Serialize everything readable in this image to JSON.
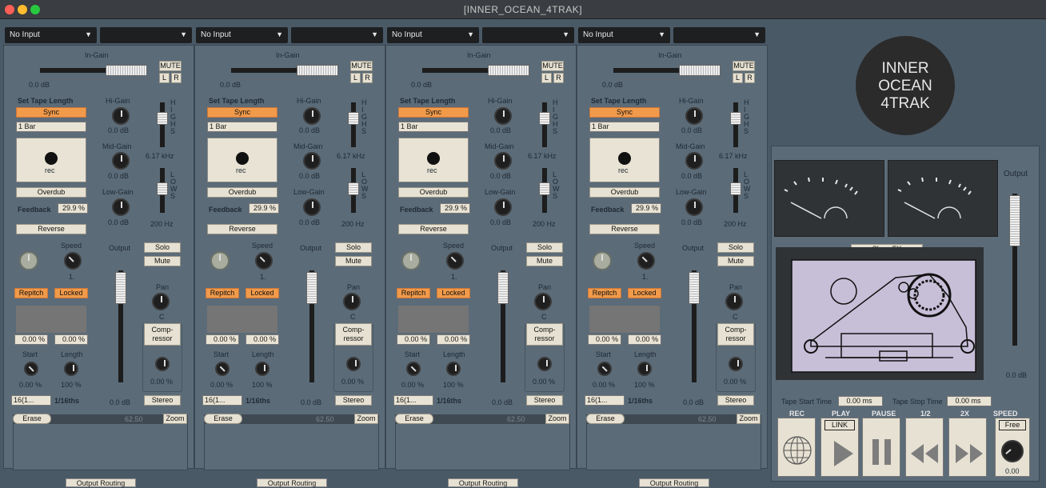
{
  "window": {
    "title": "[INNER_OCEAN_4TRAK]"
  },
  "logo": {
    "line1": "INNER",
    "line2": "OCEAN",
    "line3": "4TRAK"
  },
  "tracks": [
    {
      "input": "No Input",
      "routing": "",
      "in_gain": "In-Gain",
      "mute": "MUTE",
      "l": "L",
      "r": "R",
      "gain_db": "0.0 dB",
      "set_tape_length": "Set Tape Length",
      "sync": "Sync",
      "length": "1 Bar",
      "rec": "rec",
      "overdub": "Overdub",
      "feedback": "Feedback",
      "feedback_val": "29.9 %",
      "reverse": "Reverse",
      "speed": "Speed",
      "speed_val": "1.",
      "repitch": "Repitch",
      "locked": "Locked",
      "pct_a": "0.00 %",
      "pct_b": "0.00 %",
      "start": "Start",
      "start_val": "0.00 %",
      "length_lbl": "Length",
      "length_val": "100 %",
      "grid": "16(1...",
      "grid2": "1/16ths",
      "hi_gain": "Hi-Gain",
      "hi_val": "0.0 dB",
      "mid_gain": "Mid-Gain",
      "mid_val": "0.0 dB",
      "freq": "6.17 kHz",
      "low_gain": "Low-Gain",
      "low_val": "0.0 dB",
      "low_freq": "200 Hz",
      "highs": "HIGHS",
      "lows": "LOWS",
      "output": "Output",
      "out_db": "0.0 dB",
      "solo": "Solo",
      "mute2": "Mute",
      "pan": "Pan",
      "pan_val": "C",
      "compressor": "Comp-\nressor",
      "comp_val": "0.00 %",
      "stereo": "Stereo",
      "erase": "Erase",
      "pos": "62.50",
      "zoom": "Zoom",
      "output_routing": "Output Routing"
    },
    {
      "input": "No Input",
      "routing": "",
      "in_gain": "In-Gain",
      "mute": "MUTE",
      "l": "L",
      "r": "R",
      "gain_db": "0.0 dB",
      "set_tape_length": "Set Tape Length",
      "sync": "Sync",
      "length": "1 Bar",
      "rec": "rec",
      "overdub": "Overdub",
      "feedback": "Feedback",
      "feedback_val": "29.9 %",
      "reverse": "Reverse",
      "speed": "Speed",
      "speed_val": "1.",
      "repitch": "Repitch",
      "locked": "Locked",
      "pct_a": "0.00 %",
      "pct_b": "0.00 %",
      "start": "Start",
      "start_val": "0.00 %",
      "length_lbl": "Length",
      "length_val": "100 %",
      "grid": "16(1...",
      "grid2": "1/16ths",
      "hi_gain": "Hi-Gain",
      "hi_val": "0.0 dB",
      "mid_gain": "Mid-Gain",
      "mid_val": "0.0 dB",
      "freq": "6.17 kHz",
      "low_gain": "Low-Gain",
      "low_val": "0.0 dB",
      "low_freq": "200 Hz",
      "highs": "HIGHS",
      "lows": "LOWS",
      "output": "Output",
      "out_db": "0.0 dB",
      "solo": "Solo",
      "mute2": "Mute",
      "pan": "Pan",
      "pan_val": "C",
      "compressor": "Comp-\nressor",
      "comp_val": "0.00 %",
      "stereo": "Stereo",
      "erase": "Erase",
      "pos": "62.50",
      "zoom": "Zoom",
      "output_routing": "Output Routing"
    },
    {
      "input": "No Input",
      "routing": "",
      "in_gain": "In-Gain",
      "mute": "MUTE",
      "l": "L",
      "r": "R",
      "gain_db": "0.0 dB",
      "set_tape_length": "Set Tape Length",
      "sync": "Sync",
      "length": "1 Bar",
      "rec": "rec",
      "overdub": "Overdub",
      "feedback": "Feedback",
      "feedback_val": "29.9 %",
      "reverse": "Reverse",
      "speed": "Speed",
      "speed_val": "1.",
      "repitch": "Repitch",
      "locked": "Locked",
      "pct_a": "0.00 %",
      "pct_b": "0.00 %",
      "start": "Start",
      "start_val": "0.00 %",
      "length_lbl": "Length",
      "length_val": "100 %",
      "grid": "16(1...",
      "grid2": "1/16ths",
      "hi_gain": "Hi-Gain",
      "hi_val": "0.0 dB",
      "mid_gain": "Mid-Gain",
      "mid_val": "0.0 dB",
      "freq": "6.17 kHz",
      "low_gain": "Low-Gain",
      "low_val": "0.0 dB",
      "low_freq": "200 Hz",
      "highs": "HIGHS",
      "lows": "LOWS",
      "output": "Output",
      "out_db": "0.0 dB",
      "solo": "Solo",
      "mute2": "Mute",
      "pan": "Pan",
      "pan_val": "C",
      "compressor": "Comp-\nressor",
      "comp_val": "0.00 %",
      "stereo": "Stereo",
      "erase": "Erase",
      "pos": "62.50",
      "zoom": "Zoom",
      "output_routing": "Output Routing"
    },
    {
      "input": "No Input",
      "routing": "",
      "in_gain": "In-Gain",
      "mute": "MUTE",
      "l": "L",
      "r": "R",
      "gain_db": "0.0 dB",
      "set_tape_length": "Set Tape Length",
      "sync": "Sync",
      "length": "1 Bar",
      "rec": "rec",
      "overdub": "Overdub",
      "feedback": "Feedback",
      "feedback_val": "29.9 %",
      "reverse": "Reverse",
      "speed": "Speed",
      "speed_val": "1.",
      "repitch": "Repitch",
      "locked": "Locked",
      "pct_a": "0.00 %",
      "pct_b": "0.00 %",
      "start": "Start",
      "start_val": "0.00 %",
      "length_lbl": "Length",
      "length_val": "100 %",
      "grid": "16(1...",
      "grid2": "1/16ths",
      "hi_gain": "Hi-Gain",
      "hi_val": "0.0 dB",
      "mid_gain": "Mid-Gain",
      "mid_val": "0.0 dB",
      "freq": "6.17 kHz",
      "low_gain": "Low-Gain",
      "low_val": "0.0 dB",
      "low_freq": "200 Hz",
      "highs": "HIGHS",
      "lows": "LOWS",
      "output": "Output",
      "out_db": "0.0 dB",
      "solo": "Solo",
      "mute2": "Mute",
      "pan": "Pan",
      "pan_val": "C",
      "compressor": "Comp-\nressor",
      "comp_val": "0.00 %",
      "stereo": "Stereo",
      "erase": "Erase",
      "pos": "62.50",
      "zoom": "Zoom",
      "output_routing": "Output Routing"
    }
  ],
  "master": {
    "output": "Output",
    "out_db": "0.0 dB",
    "show_fx": "Show FX",
    "tape_start": "Tape Start Time",
    "tape_start_val": "0.00 ms",
    "tape_stop": "Tape Stop Time",
    "tape_stop_val": "0.00 ms",
    "rec": "REC",
    "play": "PLAY",
    "link": "LINK",
    "pause": "PAUSE",
    "half": "1/2",
    "double": "2X",
    "speed": "SPEED",
    "free": "Free",
    "speed_val": "0.00"
  },
  "colors": {
    "accent": "#f19a4a",
    "panel": "#5b6b78",
    "bg": "#4a5966"
  }
}
